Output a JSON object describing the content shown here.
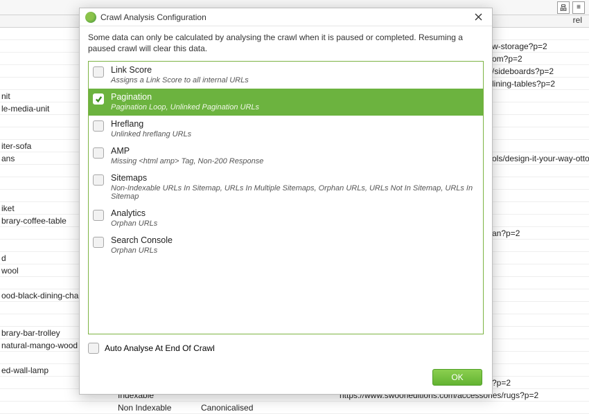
{
  "toolbar": {
    "icon1": "sitemap-icon",
    "icon2": "list-icon"
  },
  "bg": {
    "headerRight": "rel",
    "rows": [
      {
        "left": "",
        "right": ""
      },
      {
        "left": "",
        "right": "w-storage?p=2"
      },
      {
        "left": "",
        "right": "om?p=2"
      },
      {
        "left": "",
        "right": "/sideboards?p=2"
      },
      {
        "left": "",
        "right": "lining-tables?p=2"
      },
      {
        "left": "nit",
        "right": ""
      },
      {
        "left": "le-media-unit",
        "right": ""
      },
      {
        "left": "",
        "right": ""
      },
      {
        "left": "",
        "right": ""
      },
      {
        "left": "iter-sofa",
        "right": ""
      },
      {
        "left": "ans",
        "right": "ols/design-it-your-way-otto"
      },
      {
        "left": "",
        "right": ""
      },
      {
        "left": "",
        "right": ""
      },
      {
        "left": "",
        "right": ""
      },
      {
        "left": "iket",
        "right": ""
      },
      {
        "left": "brary-coffee-table",
        "right": ""
      },
      {
        "left": "",
        "right": "an?p=2"
      },
      {
        "left": "",
        "right": ""
      },
      {
        "left": "d",
        "right": ""
      },
      {
        "left": "wool",
        "right": ""
      },
      {
        "left": "",
        "right": ""
      },
      {
        "left": "ood-black-dining-chai",
        "right": ""
      },
      {
        "left": "",
        "right": ""
      },
      {
        "left": "",
        "right": ""
      },
      {
        "left": "brary-bar-trolley",
        "right": ""
      },
      {
        "left": "natural-mango-wood",
        "right": ""
      },
      {
        "left": "",
        "right": ""
      },
      {
        "left": "ed-wall-lamp",
        "right": ""
      },
      {
        "left": "",
        "right": "?p=2"
      }
    ],
    "bottomRow": {
      "col2": "Indexable",
      "col3": "",
      "col4": "https://www.swooneditions.com/accessories/rugs?p=2"
    },
    "bottomRow2": {
      "col2": "Non Indexable",
      "col3": "Canonicalised"
    }
  },
  "dialog": {
    "title": "Crawl Analysis Configuration",
    "description": "Some data can only be calculated by analysing the crawl when it is paused or completed. Resuming a paused crawl will clear this data.",
    "options": [
      {
        "label": "Link Score",
        "sub": "Assigns a Link Score to all internal URLs",
        "checked": false
      },
      {
        "label": "Pagination",
        "sub": "Pagination Loop, Unlinked Pagination URLs",
        "checked": true
      },
      {
        "label": "Hreflang",
        "sub": "Unlinked hreflang URLs",
        "checked": false
      },
      {
        "label": "AMP",
        "sub": "Missing <html amp> Tag, Non-200 Response",
        "checked": false
      },
      {
        "label": "Sitemaps",
        "sub": "Non-Indexable URLs In Sitemap, URLs In Multiple Sitemaps, Orphan URLs, URLs Not In Sitemap, URLs In Sitemap",
        "checked": false
      },
      {
        "label": "Analytics",
        "sub": "Orphan URLs",
        "checked": false
      },
      {
        "label": "Search Console",
        "sub": "Orphan URLs",
        "checked": false
      }
    ],
    "autoAnalyse": "Auto Analyse At End Of Crawl",
    "okLabel": "OK"
  }
}
